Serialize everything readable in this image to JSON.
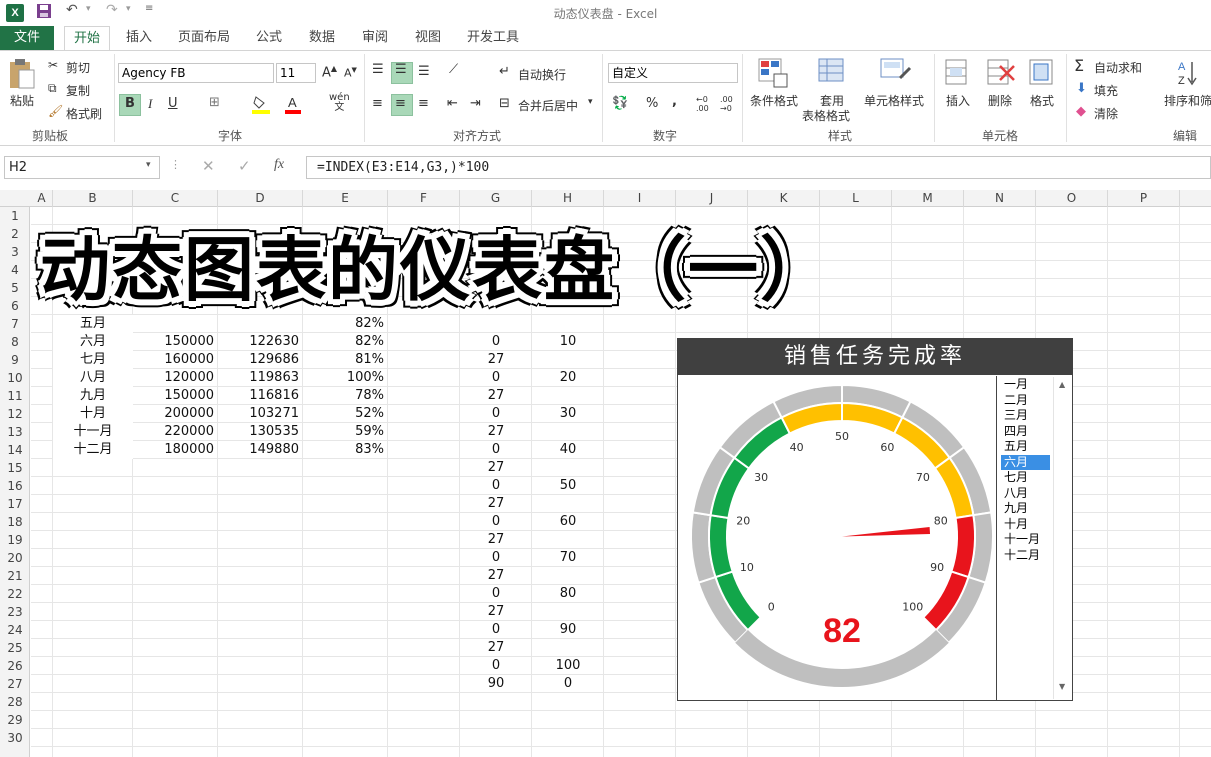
{
  "window": {
    "title": "动态仪表盘 - Excel",
    "app_icon": "X"
  },
  "quick_access": {
    "save_icon": "save-icon",
    "undo_icon": "undo-icon",
    "redo_icon": "redo-icon",
    "customize_icon": "customize-icon"
  },
  "tabs": {
    "file": "文件",
    "items": [
      "开始",
      "插入",
      "页面布局",
      "公式",
      "数据",
      "审阅",
      "视图",
      "开发工具"
    ],
    "active": "开始"
  },
  "ribbon": {
    "clipboard": {
      "paste": "粘贴",
      "cut": "剪切",
      "copy": "复制",
      "format_painter": "格式刷",
      "label": "剪贴板"
    },
    "font": {
      "name": "Agency FB",
      "size": "11",
      "bold": "B",
      "italic": "I",
      "underline": "U",
      "wen": "wén",
      "label": "字体"
    },
    "alignment": {
      "wrap": "自动换行",
      "merge": "合并后居中",
      "label": "对齐方式"
    },
    "number": {
      "format": "自定义",
      "percent": "%",
      "comma": ",",
      "label": "数字"
    },
    "styles": {
      "conditional": "条件格式",
      "table": "套用",
      "table2": "表格格式",
      "cell_styles": "单元格样式",
      "label": "样式"
    },
    "cells": {
      "insert": "插入",
      "delete": "删除",
      "format": "格式",
      "label": "单元格"
    },
    "editing": {
      "autosum": "自动求和",
      "fill": "填充",
      "clear": "清除",
      "sort": "排序和筛",
      "label": "编辑"
    }
  },
  "formula_bar": {
    "name_box": "H2",
    "fx": "fx",
    "formula": "=INDEX(E3:E14,G3,)*100"
  },
  "grid": {
    "columns": [
      "A",
      "B",
      "C",
      "D",
      "E",
      "F",
      "G",
      "H",
      "I",
      "J",
      "K",
      "L",
      "M",
      "N",
      "O",
      "P"
    ],
    "rows": [
      "1",
      "2",
      "3",
      "4",
      "5",
      "6",
      "7",
      "8",
      "9",
      "10",
      "11",
      "12",
      "13",
      "14",
      "15",
      "16",
      "17",
      "18",
      "19",
      "20",
      "21",
      "22",
      "23",
      "24",
      "25",
      "26",
      "27",
      "28",
      "29",
      "30"
    ],
    "data_rows": [
      {
        "row": 7,
        "b": "五月",
        "c": "",
        "d": "",
        "e": "82%",
        "g": "",
        "h": ""
      },
      {
        "row": 8,
        "b": "六月",
        "c": "150000",
        "d": "122630",
        "e": "82%",
        "g": "0",
        "h": "10"
      },
      {
        "row": 9,
        "b": "七月",
        "c": "160000",
        "d": "129686",
        "e": "81%",
        "g": "27",
        "h": ""
      },
      {
        "row": 10,
        "b": "八月",
        "c": "120000",
        "d": "119863",
        "e": "100%",
        "g": "0",
        "h": "20"
      },
      {
        "row": 11,
        "b": "九月",
        "c": "150000",
        "d": "116816",
        "e": "78%",
        "g": "27",
        "h": ""
      },
      {
        "row": 12,
        "b": "十月",
        "c": "200000",
        "d": "103271",
        "e": "52%",
        "g": "0",
        "h": "30"
      },
      {
        "row": 13,
        "b": "十一月",
        "c": "220000",
        "d": "130535",
        "e": "59%",
        "g": "27",
        "h": ""
      },
      {
        "row": 14,
        "b": "十二月",
        "c": "180000",
        "d": "149880",
        "e": "83%",
        "g": "0",
        "h": "40"
      },
      {
        "row": 15,
        "b": "",
        "c": "",
        "d": "",
        "e": "",
        "g": "27",
        "h": ""
      },
      {
        "row": 16,
        "b": "",
        "c": "",
        "d": "",
        "e": "",
        "g": "0",
        "h": "50"
      },
      {
        "row": 17,
        "b": "",
        "c": "",
        "d": "",
        "e": "",
        "g": "27",
        "h": ""
      },
      {
        "row": 18,
        "b": "",
        "c": "",
        "d": "",
        "e": "",
        "g": "0",
        "h": "60"
      },
      {
        "row": 19,
        "b": "",
        "c": "",
        "d": "",
        "e": "",
        "g": "27",
        "h": ""
      },
      {
        "row": 20,
        "b": "",
        "c": "",
        "d": "",
        "e": "",
        "g": "0",
        "h": "70"
      },
      {
        "row": 21,
        "b": "",
        "c": "",
        "d": "",
        "e": "",
        "g": "27",
        "h": ""
      },
      {
        "row": 22,
        "b": "",
        "c": "",
        "d": "",
        "e": "",
        "g": "0",
        "h": "80"
      },
      {
        "row": 23,
        "b": "",
        "c": "",
        "d": "",
        "e": "",
        "g": "27",
        "h": ""
      },
      {
        "row": 24,
        "b": "",
        "c": "",
        "d": "",
        "e": "",
        "g": "0",
        "h": "90"
      },
      {
        "row": 25,
        "b": "",
        "c": "",
        "d": "",
        "e": "",
        "g": "27",
        "h": ""
      },
      {
        "row": 26,
        "b": "",
        "c": "",
        "d": "",
        "e": "",
        "g": "0",
        "h": "100"
      },
      {
        "row": 27,
        "b": "",
        "c": "",
        "d": "",
        "e": "",
        "g": "90",
        "h": "0"
      }
    ]
  },
  "banner": {
    "text": "动态图表的仪表盘（一）"
  },
  "dashboard": {
    "title": "销售任务完成率",
    "value": "82",
    "value_color": "#e8141c",
    "ticks": [
      "0",
      "10",
      "20",
      "30",
      "40",
      "50",
      "60",
      "70",
      "80",
      "90",
      "100"
    ],
    "zone_colors": {
      "green": "#12a64a",
      "yellow": "#ffc000",
      "red": "#e8141c",
      "outer": "#bfbfbf"
    },
    "zones": [
      {
        "from": 0,
        "to": 40,
        "color": "green"
      },
      {
        "from": 40,
        "to": 80,
        "color": "yellow"
      },
      {
        "from": 80,
        "to": 100,
        "color": "red"
      }
    ],
    "needle_value": 82,
    "months": [
      "一月",
      "二月",
      "三月",
      "四月",
      "五月",
      "六月",
      "七月",
      "八月",
      "九月",
      "十月",
      "十一月",
      "十二月"
    ],
    "selected_month": "六月"
  }
}
